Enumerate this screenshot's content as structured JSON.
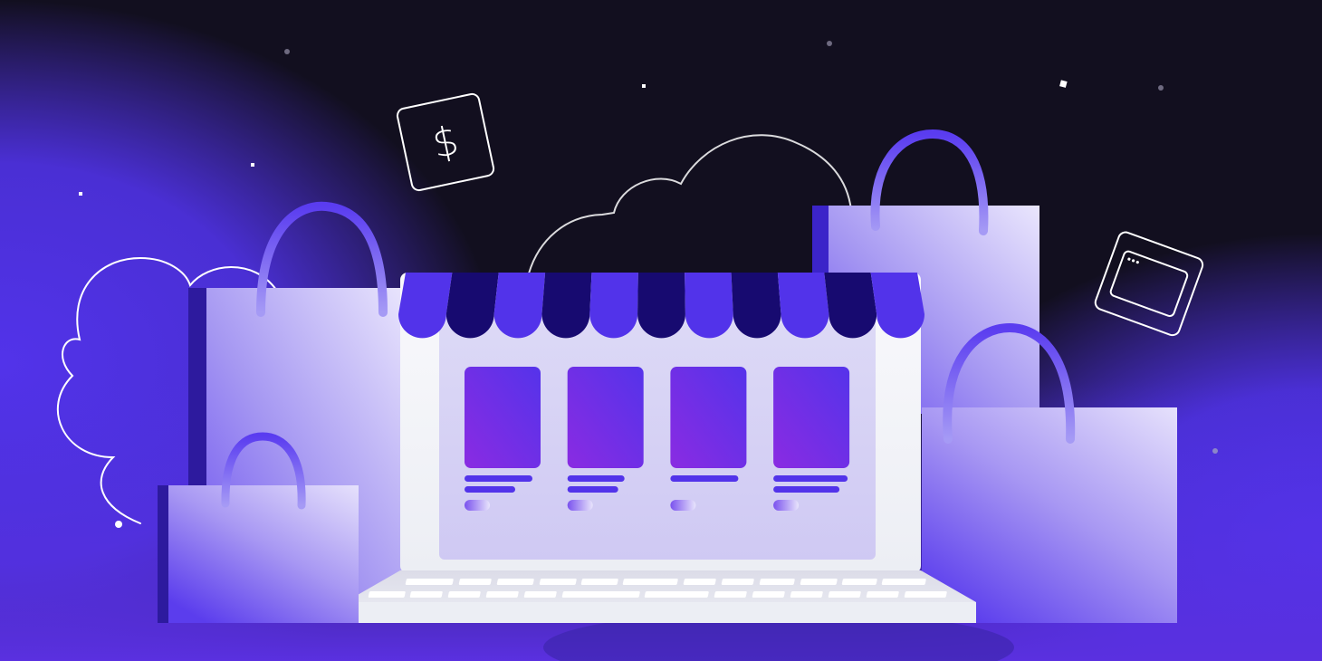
{
  "colors": {
    "background_dark": "#120f1f",
    "accent_purple": "#5233ea",
    "awning_dark": "#170a70",
    "bag_light": "#e8e4fc",
    "laptop_white": "#f7f7fb",
    "card_violet": "#8a2be2"
  },
  "icons": {
    "dollar_glyph": "$",
    "browser_window": "browser-window-icon"
  },
  "storefront": {
    "product_count": 4,
    "awning_stripes": 11
  }
}
